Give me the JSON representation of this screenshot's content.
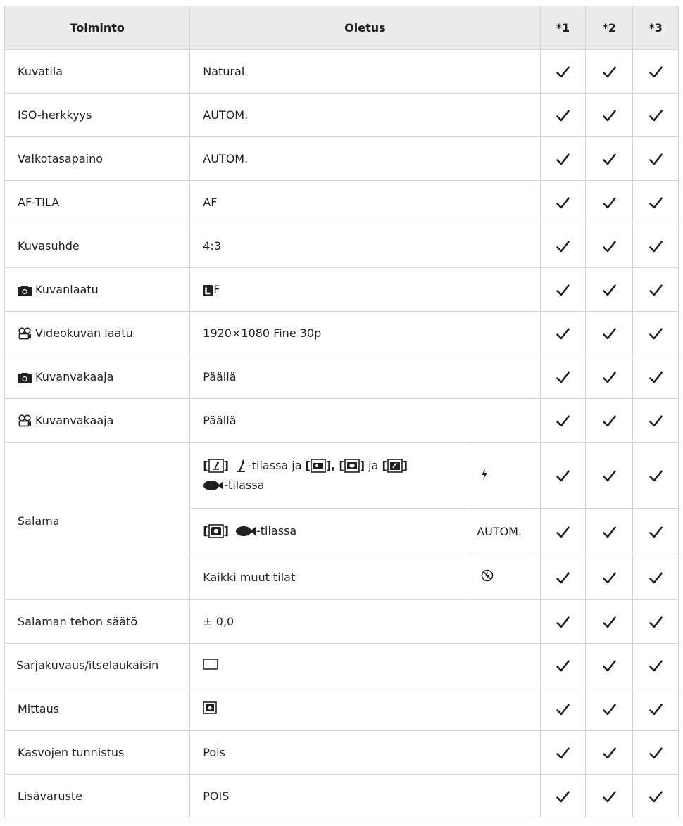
{
  "headers": {
    "toiminto": "Toiminto",
    "oletus": "Oletus",
    "c1": "*1",
    "c2": "*2",
    "c3": "*3"
  },
  "rows": [
    {
      "label": "Kuvatila",
      "value": "Natural"
    },
    {
      "label": "ISO-herkkyys",
      "value": "AUTOM."
    },
    {
      "label": "Valkotasapaino",
      "value": "AUTOM."
    },
    {
      "label": "AF-TILA",
      "value": "AF"
    },
    {
      "label": "Kuvasuhde",
      "value": "4:3"
    },
    {
      "label": "Kuvanlaatu",
      "icon": "camera-icon",
      "value": "F",
      "value_icon": "large-size-icon"
    },
    {
      "label": "Videokuvan laatu",
      "icon": "movie-icon",
      "value": "1920×1080 Fine 30p"
    },
    {
      "label": "Kuvanvakaaja",
      "icon": "camera-icon",
      "value": "Päällä"
    },
    {
      "label": "Kuvanvakaaja",
      "icon": "movie-icon",
      "value": "Päällä"
    }
  ],
  "flash": {
    "label": "Salama",
    "sub": [
      {
        "text_a": "-tilassa ja ",
        "text_b": " ja ",
        "text_c": "-tilassa",
        "value_icon": "flash-icon"
      },
      {
        "text": "-tilassa",
        "value": "AUTOM."
      },
      {
        "text": "Kaikki muut tilat",
        "value_icon": "flash-off-icon"
      }
    ]
  },
  "rows2": [
    {
      "label": "Salaman tehon säätö",
      "value": "± 0,0"
    },
    {
      "label": "Sarjakuvaus/itselaukaisin",
      "value_icon": "single-frame-icon"
    },
    {
      "label": "Mittaus",
      "value_icon": "metering-icon"
    },
    {
      "label": "Kasvojen tunnistus",
      "value": "Pois"
    },
    {
      "label": "Lisävaruste",
      "value": "POIS"
    }
  ],
  "brackets": {
    "open": "[",
    "close": "]",
    "sep": "],"
  }
}
